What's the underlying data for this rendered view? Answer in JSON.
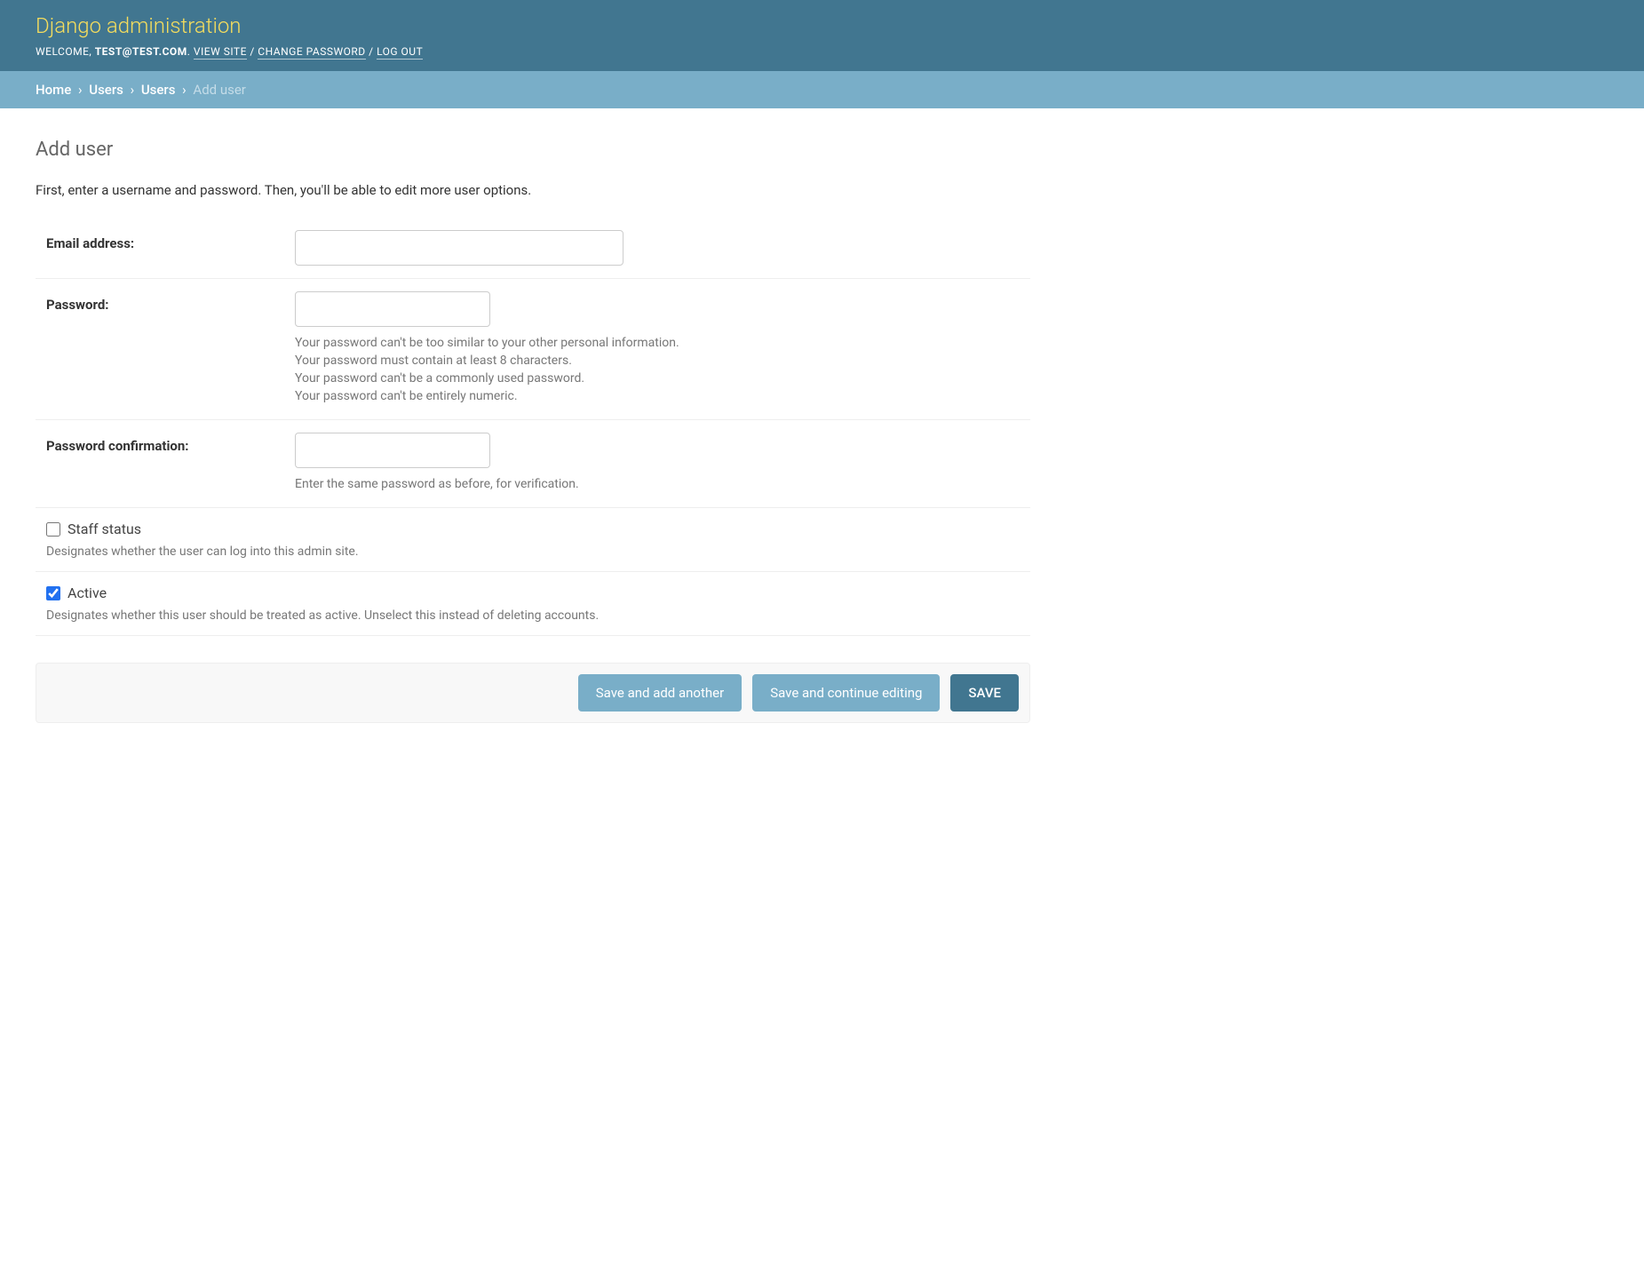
{
  "branding": {
    "title": "Django administration"
  },
  "user_tools": {
    "welcome_prefix": "WELCOME, ",
    "username": "TEST@TEST.COM",
    "period": ". ",
    "view_site": "VIEW SITE",
    "sep": " / ",
    "change_password": "CHANGE PASSWORD",
    "log_out": "LOG OUT"
  },
  "breadcrumbs": {
    "home": "Home",
    "app": "Users",
    "model": "Users",
    "current": "Add user",
    "sep": "›"
  },
  "page": {
    "title": "Add user",
    "intro": "First, enter a username and password. Then, you'll be able to edit more user options."
  },
  "fields": {
    "email": {
      "label": "Email address:",
      "value": ""
    },
    "password": {
      "label": "Password:",
      "value": "",
      "help": [
        "Your password can't be too similar to your other personal information.",
        "Your password must contain at least 8 characters.",
        "Your password can't be a commonly used password.",
        "Your password can't be entirely numeric."
      ]
    },
    "password_confirm": {
      "label": "Password confirmation:",
      "value": "",
      "help": "Enter the same password as before, for verification."
    },
    "staff_status": {
      "label": "Staff status",
      "checked": false,
      "help": "Designates whether the user can log into this admin site."
    },
    "active": {
      "label": "Active",
      "checked": true,
      "help": "Designates whether this user should be treated as active. Unselect this instead of deleting accounts."
    }
  },
  "buttons": {
    "save_add_another": "Save and add another",
    "save_continue": "Save and continue editing",
    "save": "SAVE"
  }
}
